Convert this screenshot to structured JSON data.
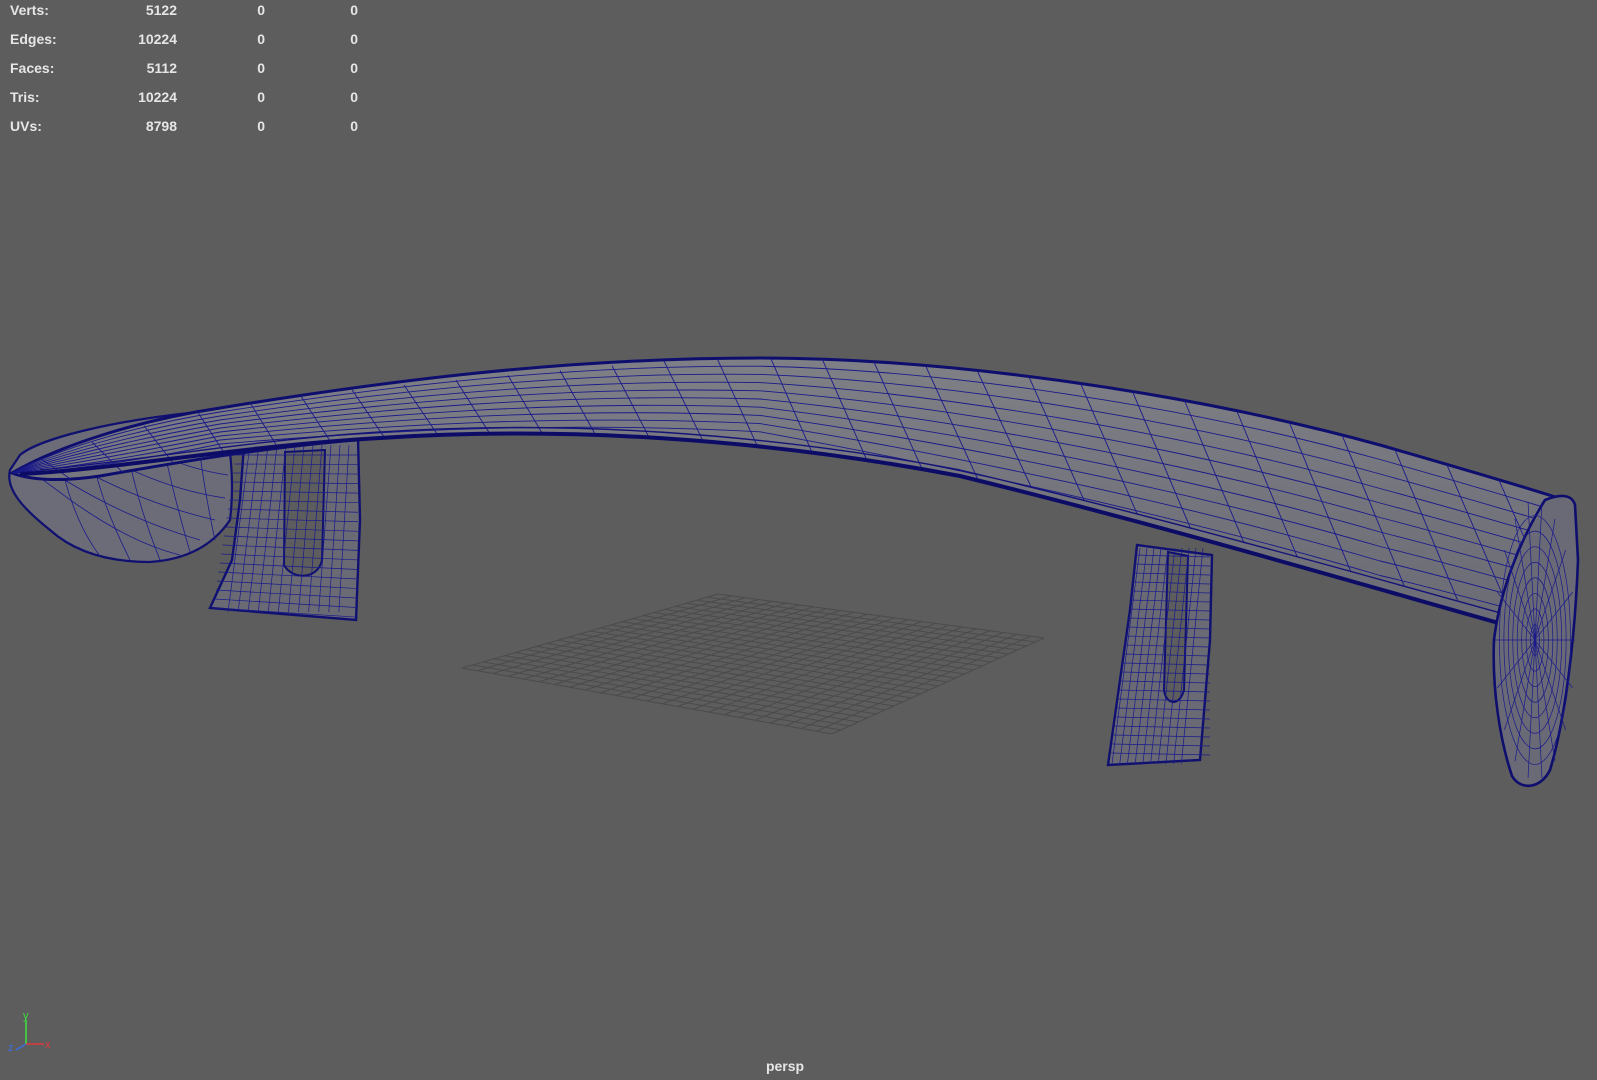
{
  "hud": {
    "rows": [
      {
        "label": "Verts:",
        "total": "5122",
        "selected": "0",
        "component": "0"
      },
      {
        "label": "Edges:",
        "total": "10224",
        "selected": "0",
        "component": "0"
      },
      {
        "label": "Faces:",
        "total": "5112",
        "selected": "0",
        "component": "0"
      },
      {
        "label": "Tris:",
        "total": "10224",
        "selected": "0",
        "component": "0"
      },
      {
        "label": "UVs:",
        "total": "8798",
        "selected": "0",
        "component": "0"
      }
    ]
  },
  "viewport": {
    "camera": "persp",
    "background_color": "#5d5d5d",
    "wire_color": "#1a1a8a",
    "grid_color": "#4a4a4a"
  },
  "axis_gizmo": {
    "y": "y",
    "x": "x",
    "z": "z"
  },
  "icons": [
    "axis-gizmo-icon"
  ]
}
